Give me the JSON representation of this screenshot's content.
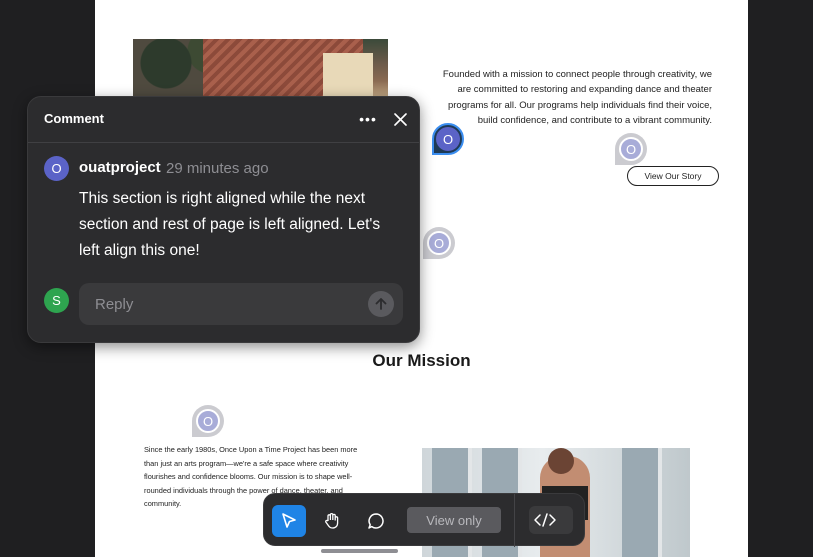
{
  "page": {
    "story_text": "Founded with a mission to connect people through creativity, we are committed to restoring and expanding dance and theater programs for all. Our programs help individuals find their voice, build confidence, and contribute to a vibrant community.",
    "story_button": "View  Our Story",
    "mission_heading": "Our Mission",
    "mission_text": "Since the early 1980s, Once Upon a Time Project has been more than just an arts program—we're a safe space where creativity flourishes and confidence blooms. Our mission is to shape well-rounded individuals through the power of dance, theater, and community."
  },
  "pins": [
    {
      "label": "O",
      "state": "active"
    },
    {
      "label": "O",
      "state": "faded"
    },
    {
      "label": "O",
      "state": "faded"
    },
    {
      "label": "O",
      "state": "faded"
    }
  ],
  "comment_panel": {
    "title": "Comment",
    "author_initial": "O",
    "author": "ouatproject",
    "time": "29 minutes ago",
    "body": "This section is right aligned while the next section and rest of page is left aligned. Let's left align this one!",
    "current_user_initial": "S",
    "reply_placeholder": "Reply",
    "colors": {
      "author_avatar": "#5b63c7",
      "user_avatar": "#2ea44f",
      "panel_bg": "#2c2c2e"
    }
  },
  "toolbar": {
    "tools": [
      "select-pointer",
      "hand-pan",
      "comment-bubble"
    ],
    "selected_tool": "select-pointer",
    "view_only_label": "View only",
    "code_icon": "</>",
    "accent": "#1f84e6"
  }
}
